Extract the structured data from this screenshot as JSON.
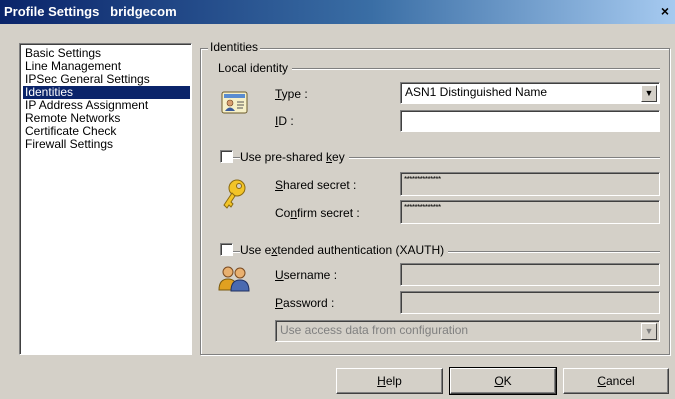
{
  "window": {
    "title": "Profile Settings   bridgecom",
    "close_glyph": "×"
  },
  "sidebar": {
    "items": [
      {
        "label": "Basic Settings",
        "selected": false
      },
      {
        "label": "Line Management",
        "selected": false
      },
      {
        "label": "IPSec General Settings",
        "selected": false
      },
      {
        "label": "Identities",
        "selected": true
      },
      {
        "label": "IP Address Assignment",
        "selected": false
      },
      {
        "label": "Remote Networks",
        "selected": false
      },
      {
        "label": "Certificate Check",
        "selected": false
      },
      {
        "label": "Firewall Settings",
        "selected": false
      }
    ]
  },
  "panel": {
    "legend": "Identities",
    "local_identity": {
      "group_label": "Local identity",
      "type_label_u": "T",
      "type_label_rest": "ype :",
      "type_value": "ASN1 Distinguished Name",
      "id_label_u": "I",
      "id_label_rest": "D :",
      "id_value": ""
    },
    "psk": {
      "checkbox_label_pre": "Use pre-shared ",
      "checkbox_label_u": "k",
      "checkbox_label_post": "ey",
      "checked": false,
      "shared_label_u": "S",
      "shared_label_rest": "hared secret :",
      "shared_value": "**************",
      "confirm_label_pre": "Co",
      "confirm_label_u": "n",
      "confirm_label_post": "firm secret :",
      "confirm_value": "**************"
    },
    "xauth": {
      "checkbox_label_pre": "Use e",
      "checkbox_label_u": "x",
      "checkbox_label_post": "tended authentication (XAUTH)",
      "checked": false,
      "username_label_u": "U",
      "username_label_rest": "sername :",
      "username_value": "",
      "password_label_u": "P",
      "password_label_rest": "assword :",
      "password_value": "",
      "access_select_value": "Use access data from configuration"
    }
  },
  "buttons": {
    "help_u": "H",
    "help_rest": "elp",
    "ok_u": "O",
    "ok_rest": "K",
    "cancel_u": "C",
    "cancel_rest": "ancel"
  }
}
